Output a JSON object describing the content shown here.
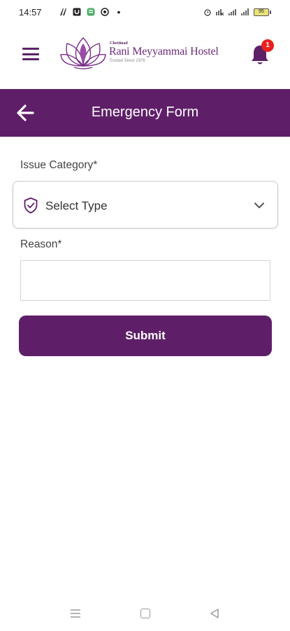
{
  "status_bar": {
    "time": "14:57",
    "battery": "95"
  },
  "header": {
    "logo_small": "Chettinad",
    "logo_name": "Rani Meyyammai Hostel",
    "logo_tagline": "Trusted Since 1976",
    "notification_count": "1"
  },
  "app_bar": {
    "title": "Emergency Form"
  },
  "form": {
    "issue_label": "Issue Category*",
    "issue_selected": "Select Type",
    "reason_label": "Reason*",
    "reason_value": "",
    "submit_label": "Submit"
  },
  "colors": {
    "primary": "#5e1f68",
    "badge": "#e8211e"
  },
  "icons": {
    "menu": "hamburger-icon",
    "notification": "bell-icon",
    "back": "arrow-left-icon",
    "category": "shield-check-icon",
    "dropdown": "chevron-down-icon"
  }
}
